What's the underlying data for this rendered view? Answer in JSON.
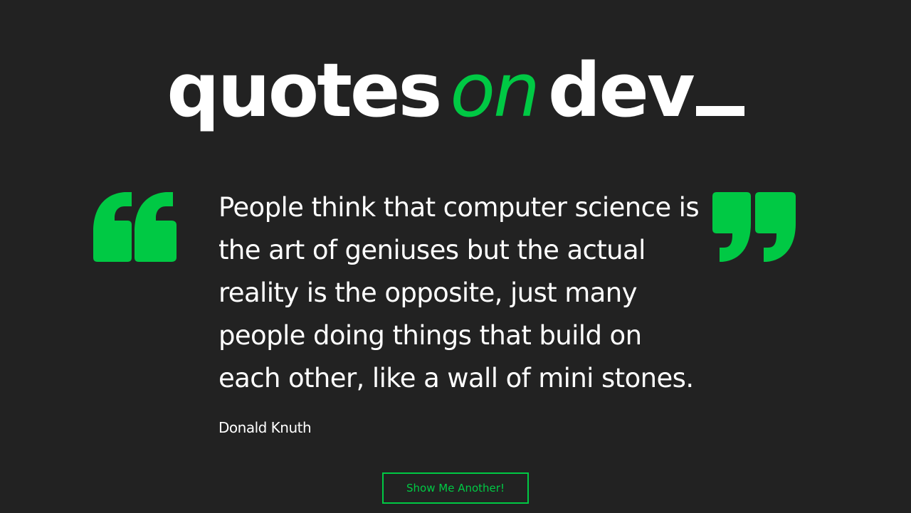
{
  "colors": {
    "background": "#222222",
    "accent": "#00c944",
    "text": "#ffffff"
  },
  "logo": {
    "part1": "quotes",
    "part2": "on",
    "part3": "dev"
  },
  "icons": {
    "open_quote": "open-quote-icon",
    "close_quote": "close-quote-icon"
  },
  "quote": {
    "text": "People think that computer science is the art of geniuses but the actual reality is the opposite, just many people doing things that build on each other, like a wall of mini stones.",
    "author": "Donald Knuth"
  },
  "button": {
    "label": "Show Me Another!"
  }
}
